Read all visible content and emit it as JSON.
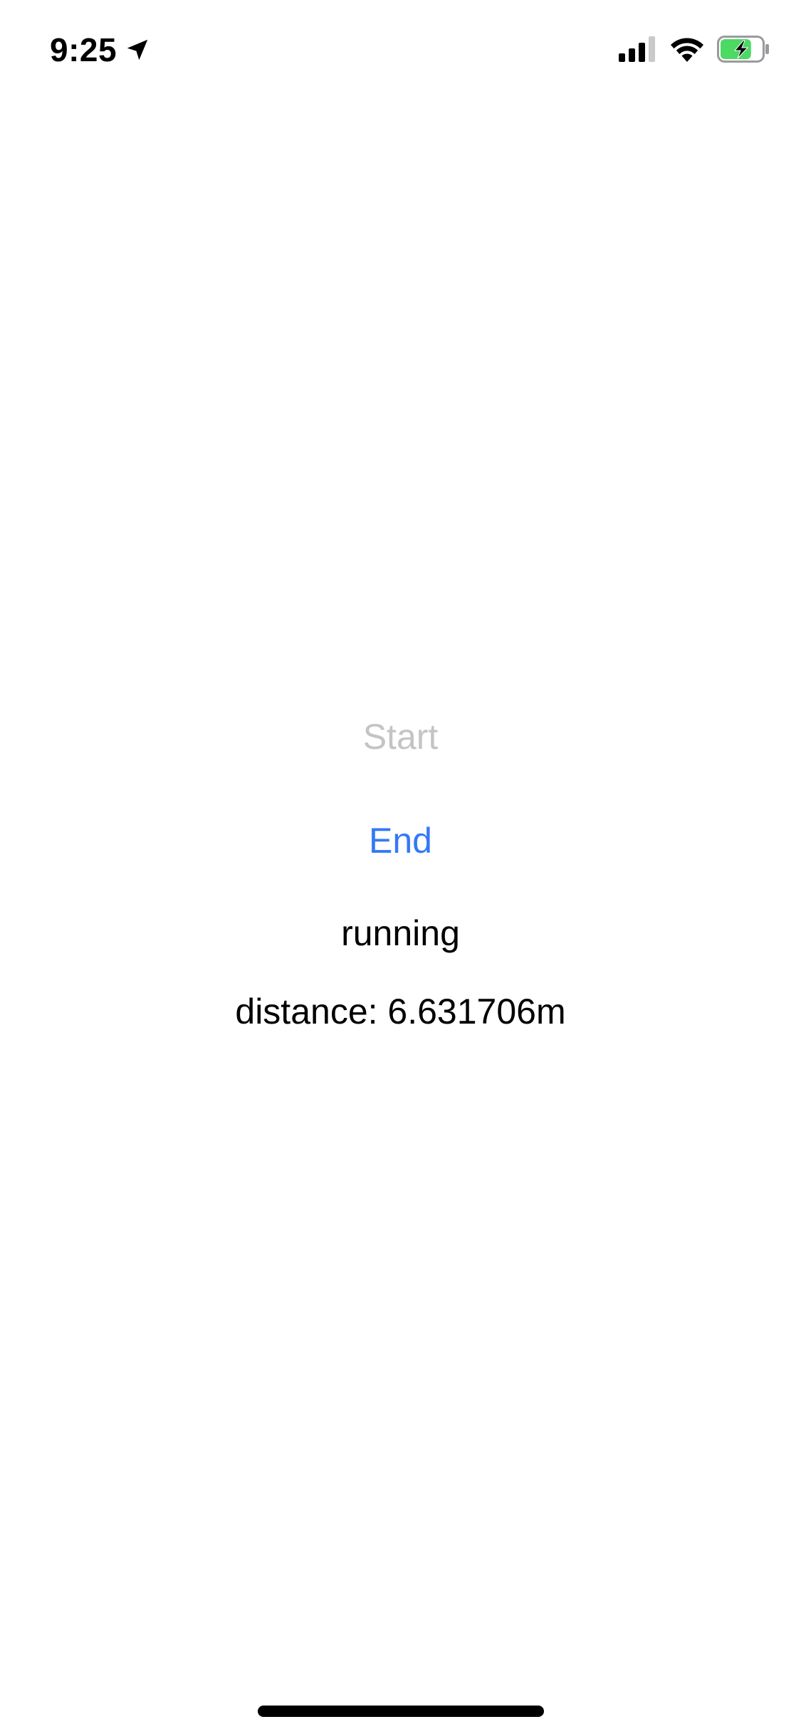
{
  "status_bar": {
    "time": "9:25",
    "location_icon": "location-arrow-icon",
    "signal_icon": "cellular-signal-icon",
    "wifi_icon": "wifi-icon",
    "battery_icon": "battery-charging-icon",
    "battery_level": 0.75,
    "battery_color": "#4cd964"
  },
  "main": {
    "start_label": "Start",
    "end_label": "End",
    "status_text": "running",
    "distance_text": "distance: 6.631706m"
  },
  "colors": {
    "accent": "#3478f6",
    "disabled": "#c4c4c6",
    "text": "#000000",
    "background": "#ffffff"
  }
}
